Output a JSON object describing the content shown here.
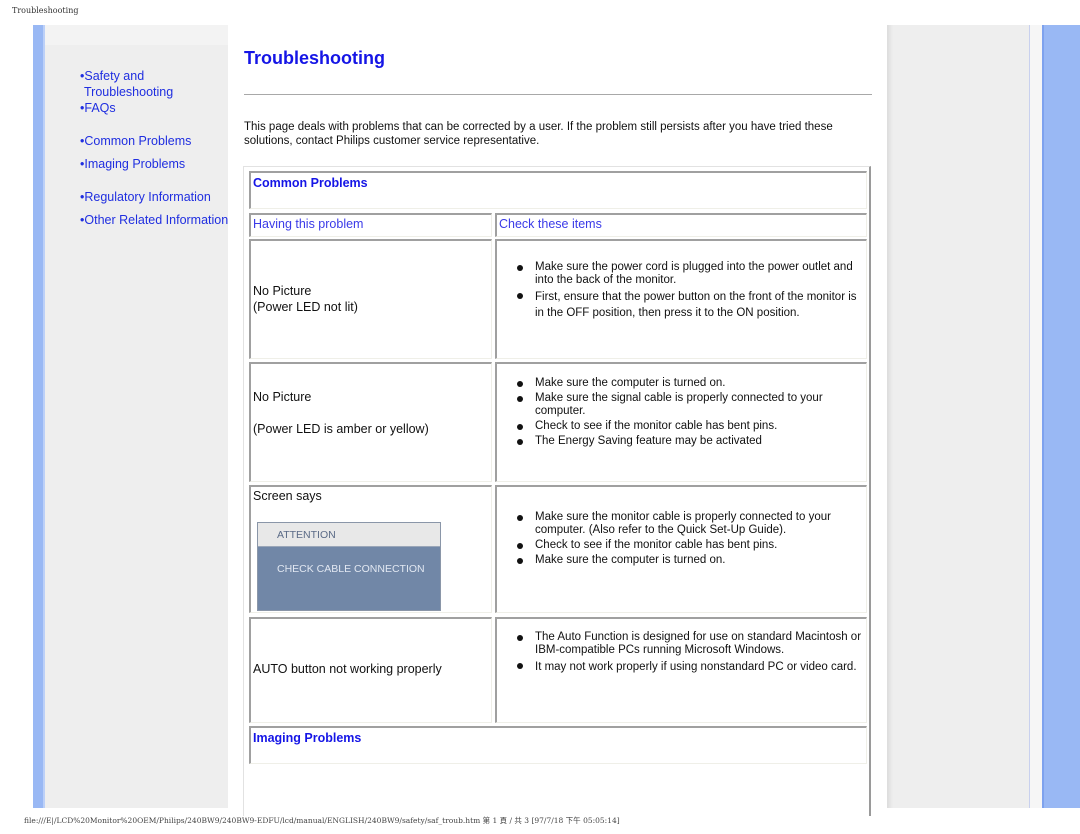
{
  "print_header": "Troubleshooting",
  "print_footer": "file:///E|/LCD%20Monitor%20OEM/Philips/240BW9/240BW9-EDFU/lcd/manual/ENGLISH/240BW9/safety/saf_troub.htm 第 1 頁 / 共 3 [97/7/18 下午 05:05:14]",
  "nav": {
    "items": [
      {
        "label": "•Safety and"
      },
      {
        "label": "Troubleshooting"
      },
      {
        "label": "•FAQs"
      },
      {
        "label": "•Common Problems"
      },
      {
        "label": "•Imaging Problems"
      },
      {
        "label": "•Regulatory Information"
      },
      {
        "label": "•Other Related Information"
      }
    ]
  },
  "page": {
    "title": "Troubleshooting",
    "intro": "This page deals with problems that can be corrected by a user. If the problem still persists after you have tried these solutions, contact Philips customer service representative."
  },
  "table": {
    "section_common": "Common Problems",
    "col_problem": "Having this problem",
    "col_check": "Check these items",
    "rows": [
      {
        "problem_line1": "No Picture",
        "problem_line2": "(Power LED not lit)",
        "checks": [
          "Make sure the power cord is plugged into the power outlet and into the back of the monitor.",
          "First, ensure that the power button on the front of the monitor is in the OFF position, then press it to the ON position."
        ]
      },
      {
        "problem_line1": "No Picture",
        "problem_line2": "(Power LED is amber or yellow)",
        "checks": [
          "Make sure the computer is turned on.",
          "Make sure the signal cable is properly connected to your computer.",
          "Check to see if the monitor cable has bent pins.",
          "The Energy Saving feature may be activated"
        ]
      },
      {
        "problem_line1": "Screen says",
        "osd_title": "ATTENTION",
        "osd_message": "CHECK CABLE CONNECTION",
        "checks": [
          "Make sure the monitor cable is properly connected to your computer. (Also refer to the Quick Set-Up Guide).",
          "Check to see if the monitor cable has bent pins.",
          "Make sure the computer is turned on."
        ]
      },
      {
        "problem_line1": "AUTO button not working properly",
        "checks": [
          "The Auto Function is designed for use on standard Macintosh or IBM-compatible PCs running Microsoft Windows.",
          "It may not work properly if using nonstandard PC or video card."
        ]
      }
    ],
    "section_imaging": "Imaging Problems"
  }
}
